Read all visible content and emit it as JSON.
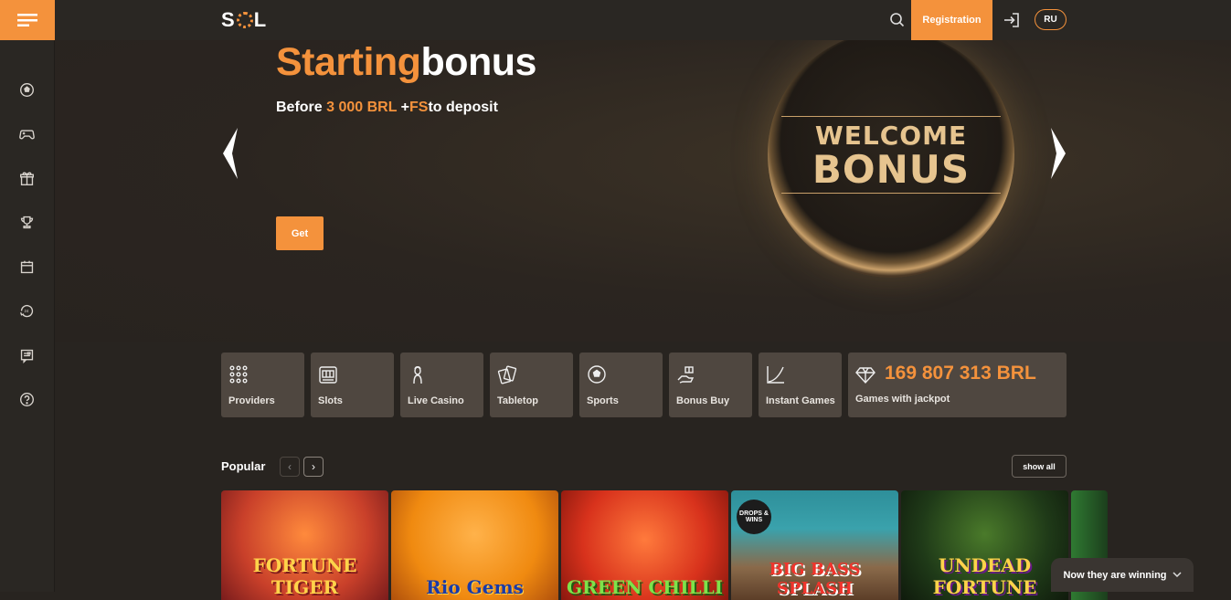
{
  "header": {
    "logo_left": "S",
    "logo_right": "L",
    "registration_label": "Registration",
    "language_label": "RU"
  },
  "sidebar": {
    "items": [
      "soccer-ball-icon",
      "gamepad-icon",
      "gift-icon",
      "trophy-icon",
      "calendar-icon",
      "support-24-icon",
      "chat-icon",
      "help-icon"
    ]
  },
  "hero": {
    "title_orange": "Starting",
    "title_white": "bonus",
    "sub_before": "Before ",
    "sub_amount": "3 000 BRL",
    "sub_plus": " +",
    "sub_fs": "FS",
    "sub_after": "to deposit",
    "get_label": "Get",
    "coin_line1": "WELCOME",
    "coin_line2": "BONUS"
  },
  "categories": {
    "providers": "Providers",
    "slots": "Slots",
    "live_casino": "Live Casino",
    "tabletop": "Tabletop",
    "sports": "Sports",
    "bonus_buy": "Bonus Buy",
    "instant_games": "Instant Games",
    "jackpot_amount": "169 807 313 BRL",
    "jackpot_label": "Games with jackpot"
  },
  "popular": {
    "title": "Popular",
    "show_all_label": "show all",
    "games": [
      {
        "name": "FORTUNE TIGER"
      },
      {
        "name": "Rio Gems"
      },
      {
        "name": "GREEN CHILLI"
      },
      {
        "name": "BIG BASS SPLASH",
        "badge": "DROPS & WINS"
      },
      {
        "name": "UNDEAD FORTUNE"
      }
    ]
  },
  "footer": {
    "winning_label": "Now they are winning"
  },
  "colors": {
    "accent": "#f4923c",
    "background": "#282420",
    "tile": "#4f4740"
  }
}
